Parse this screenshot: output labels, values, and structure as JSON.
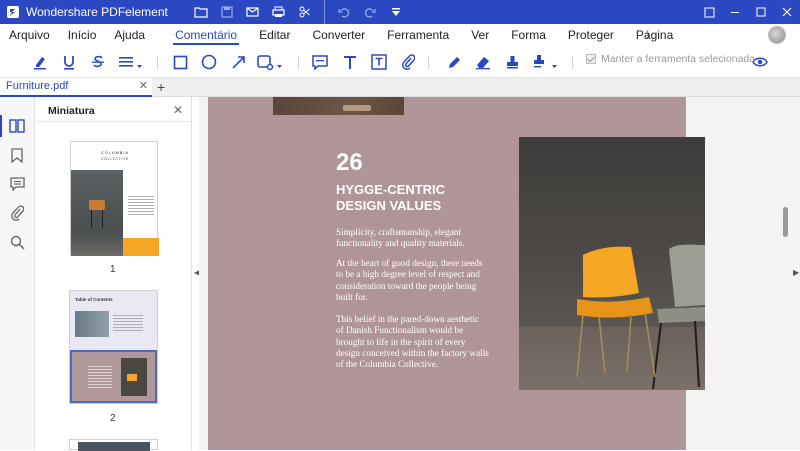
{
  "app": {
    "title": "Wondershare PDFelement"
  },
  "menu": {
    "items": [
      "Arquivo",
      "Início",
      "Ajuda",
      "Comentário",
      "Editar",
      "Converter",
      "Ferramenta",
      "Ver",
      "Forma",
      "Proteger",
      "Página"
    ],
    "active": "Comentário"
  },
  "toolbar": {
    "tools": [
      "highlight-icon",
      "underline-icon",
      "strikethrough-icon",
      "lines-dropdown-icon",
      "rectangle-icon",
      "circle-icon",
      "arrow-icon",
      "shapes-dropdown-icon",
      "sticky-note-icon",
      "text-icon",
      "textbox-icon",
      "attachment-icon",
      "pencil-icon",
      "eraser-icon",
      "stamp-icon",
      "signature-dropdown-icon",
      "eye-icon"
    ],
    "keep_tool_label": "Manter a ferramenta selecionada"
  },
  "tabs": [
    {
      "label": "Furniture.pdf"
    }
  ],
  "thumbnails": {
    "header": "Miniatura",
    "pages": [
      {
        "number": "1"
      },
      {
        "number": "2"
      }
    ],
    "page1": {
      "brand": "COLUMBIA",
      "brand2": "COLLECTIVE"
    },
    "page2": {
      "toc": "Table of Contents"
    }
  },
  "document": {
    "number": "26",
    "title_lines": [
      "HYGGE-CENTRIC",
      "DESIGN VALUES"
    ],
    "paragraphs": [
      [
        "Simplicity, craftsmanship, elegant",
        "functionality and quality materials."
      ],
      [
        "At the heart of good design, there needs",
        "to be a high degree level of respect and",
        "consideration toward the people being",
        "built for."
      ],
      [
        "This belief in the pared-down aesthetic",
        "of Danish Functionalism would be",
        "brought to life in the spirit of every",
        "design conceived within the factory walls",
        "of the Columbia Collective."
      ]
    ]
  },
  "colors": {
    "accent": "#2b48c2",
    "page_bg": "#af9598",
    "chair": "#f5a623"
  }
}
